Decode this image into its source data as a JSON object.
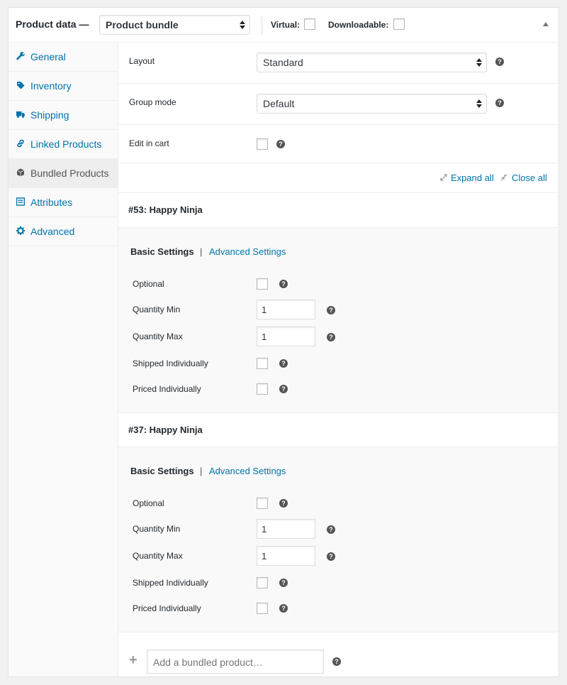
{
  "header": {
    "title": "Product data —",
    "product_type": "Product bundle",
    "virtual_label": "Virtual:",
    "downloadable_label": "Downloadable:"
  },
  "sidebar": {
    "items": [
      {
        "label": "General",
        "icon": "wrench-icon"
      },
      {
        "label": "Inventory",
        "icon": "tag-icon"
      },
      {
        "label": "Shipping",
        "icon": "truck-icon"
      },
      {
        "label": "Linked Products",
        "icon": "link-icon"
      },
      {
        "label": "Bundled Products",
        "icon": "cube-icon",
        "active": true
      },
      {
        "label": "Attributes",
        "icon": "list-icon"
      },
      {
        "label": "Advanced",
        "icon": "gear-icon"
      }
    ]
  },
  "main": {
    "layout_label": "Layout",
    "layout_value": "Standard",
    "group_mode_label": "Group mode",
    "group_mode_value": "Default",
    "edit_in_cart_label": "Edit in cart",
    "expand_all": "Expand all",
    "close_all": "Close all",
    "help_glyph": "?",
    "bundled_items": [
      {
        "title": "#53: Happy Ninja",
        "basic_settings": "Basic Settings",
        "separator": "|",
        "advanced_settings": "Advanced Settings",
        "optional_label": "Optional",
        "qty_min_label": "Quantity Min",
        "qty_min_value": "1",
        "qty_max_label": "Quantity Max",
        "qty_max_value": "1",
        "shipped_label": "Shipped Individually",
        "priced_label": "Priced Individually"
      },
      {
        "title": "#37: Happy Ninja",
        "basic_settings": "Basic Settings",
        "separator": "|",
        "advanced_settings": "Advanced Settings",
        "optional_label": "Optional",
        "qty_min_label": "Quantity Min",
        "qty_min_value": "1",
        "qty_max_label": "Quantity Max",
        "qty_max_value": "1",
        "shipped_label": "Shipped Individually",
        "priced_label": "Priced Individually"
      }
    ],
    "add_placeholder": "Add a bundled product…"
  },
  "colors": {
    "link": "#0073aa",
    "text": "#23282d",
    "sidebar_bg": "#fafafa",
    "active_tab_bg": "#eeeeee",
    "item_body_bg": "#f9f9f9"
  }
}
